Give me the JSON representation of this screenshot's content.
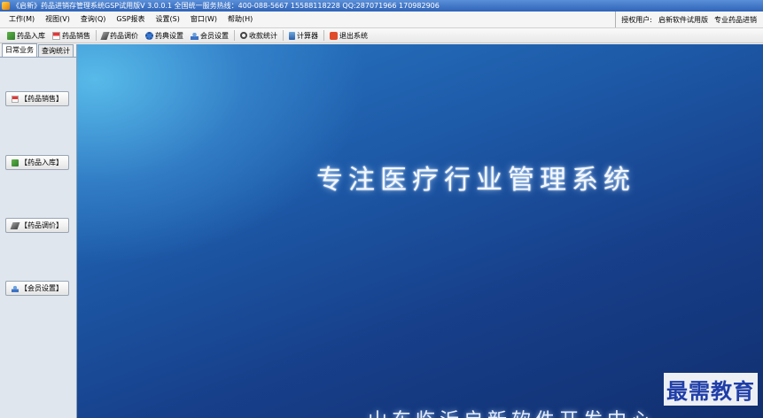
{
  "window": {
    "title": "《启新》药品进销存管理系统GSP试用版V 3.0.0.1 全国统一服务热线：400-088-5667 15588118228 QQ:287071966 170982906"
  },
  "menubar": {
    "items": [
      "工作(M)",
      "视图(V)",
      "查询(Q)",
      "GSP报表",
      "设置(S)",
      "窗口(W)",
      "帮助(H)"
    ],
    "auth_label": "授权用户:",
    "auth_user": "启新软件试用版",
    "auth_extra": "专业药品进销"
  },
  "toolbar": {
    "items": [
      {
        "label": "药品入库",
        "icon": "box-in-icon"
      },
      {
        "label": "药品销售",
        "icon": "sale-icon"
      },
      {
        "label": "药品调价",
        "icon": "price-pen-icon"
      },
      {
        "label": "药典设置",
        "icon": "gear-icon"
      },
      {
        "label": "会员设置",
        "icon": "member-icon"
      },
      {
        "label": "收款统计",
        "icon": "magnifier-icon"
      },
      {
        "label": "计算器",
        "icon": "calculator-icon"
      },
      {
        "label": "退出系统",
        "icon": "exit-icon"
      }
    ]
  },
  "sidebar": {
    "tabs": [
      "日常业务",
      "查询统计"
    ],
    "buttons": [
      {
        "label": "【药品销售】"
      },
      {
        "label": "【药品入库】"
      },
      {
        "label": "【药品调价】"
      },
      {
        "label": "【会员设置】"
      }
    ]
  },
  "main": {
    "title": "专注医疗行业管理系统",
    "subtitle": "山东临沂启新软件开发中心"
  },
  "watermark": "最需教育",
  "colors": {
    "titlebar": "#2f63b8",
    "main_bg_dark": "#112f6f",
    "main_bg_light": "#5abeeb",
    "watermark_text": "#1f3ea8"
  }
}
